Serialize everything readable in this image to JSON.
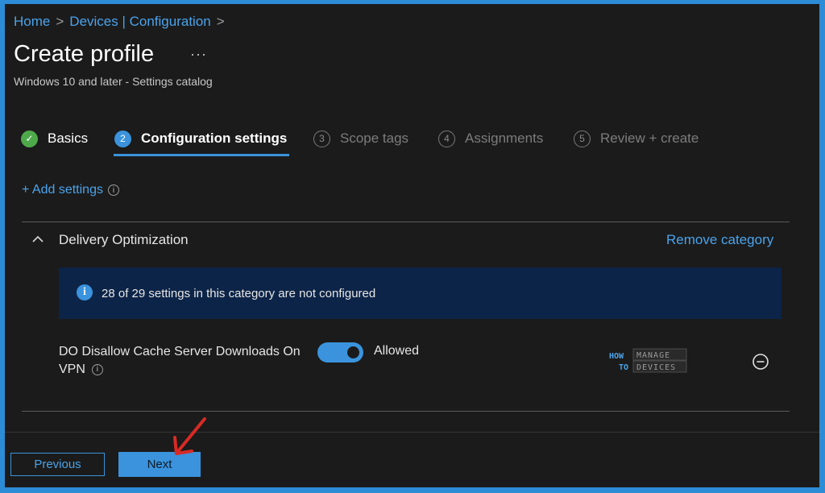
{
  "breadcrumb": {
    "home": "Home",
    "devices_config": "Devices | Configuration",
    "sep": ">"
  },
  "header": {
    "title": "Create profile",
    "more": "···",
    "subtitle": "Windows 10 and later - Settings catalog"
  },
  "steps": [
    {
      "number": "✓",
      "label": "Basics",
      "state": "done"
    },
    {
      "number": "2",
      "label": "Configuration settings",
      "state": "active"
    },
    {
      "number": "3",
      "label": "Scope tags",
      "state": "future"
    },
    {
      "number": "4",
      "label": "Assignments",
      "state": "future"
    },
    {
      "number": "5",
      "label": "Review + create",
      "state": "future"
    }
  ],
  "add_settings": {
    "label": "+ Add settings",
    "info_glyph": "i"
  },
  "category": {
    "title": "Delivery Optimization",
    "remove_label": "Remove category",
    "info_banner": "28 of 29 settings in this category are not configured",
    "info_glyph": "i"
  },
  "setting": {
    "name_line1": "DO Disallow Cache Server Downloads On",
    "name_line2": "VPN",
    "info_glyph": "i",
    "toggle_on": true,
    "value_label": "Allowed"
  },
  "watermark": {
    "how": "HOW",
    "to": "TO",
    "manage": "MANAGE",
    "devices": "DEVICES"
  },
  "footer": {
    "previous_label": "Previous",
    "next_label": "Next"
  },
  "colors": {
    "accent": "#3a93dc",
    "link": "#4aa3ec",
    "background": "#1b1b1b",
    "banner": "#0c2447",
    "success": "#4ea94a",
    "annotation_arrow": "#d92a25"
  }
}
